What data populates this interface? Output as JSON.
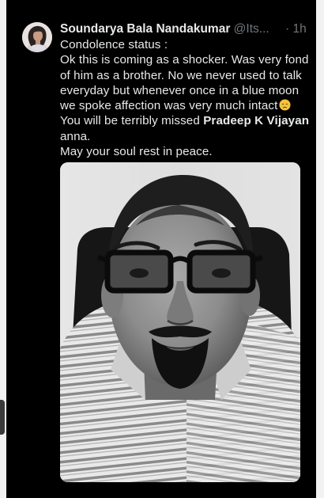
{
  "tweet": {
    "author_name": "Soundarya Bala Nandakumar",
    "handle": "@Its...",
    "separator": "·",
    "time": "1h",
    "lines": [
      "Condolence status :",
      "Ok this is coming as a shocker. Was very fond",
      "of him as a brother. No we never used to talk",
      "everyday but whenever once in a blue moon",
      "we spoke affection was very much intact",
      "You will be terribly missed",
      "Pradeep K Vijayan",
      "anna.",
      "May your soul rest in peace."
    ]
  },
  "icons": {
    "avatar": "profile-photo-avatar",
    "emoji": "disappointed-face-emoji",
    "media": "black-and-white-portrait-photo"
  },
  "colors": {
    "background": "#000000",
    "text_primary": "#e7e9ea",
    "text_secondary": "#71767b",
    "emoji_yellow": "#f4c23c"
  }
}
